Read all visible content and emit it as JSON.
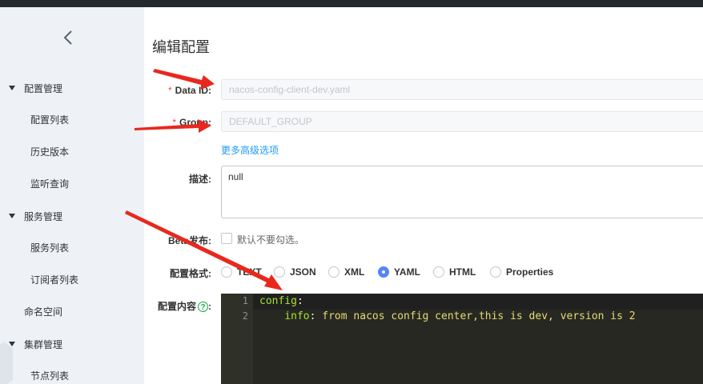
{
  "sidebar": {
    "groups": [
      {
        "label": "配置管理",
        "items": [
          "配置列表",
          "历史版本",
          "监听查询"
        ]
      },
      {
        "label": "服务管理",
        "items": [
          "服务列表",
          "订阅者列表"
        ]
      },
      {
        "label": "集群管理",
        "items": [
          "节点列表"
        ]
      }
    ],
    "namespace": "命名空间"
  },
  "page": {
    "title": "编辑配置"
  },
  "form": {
    "data_id": {
      "label": "Data ID:",
      "value": "nacos-config-client-dev.yaml"
    },
    "group": {
      "label": "Group:",
      "value": "DEFAULT_GROUP"
    },
    "more_options": "更多高级选项",
    "desc": {
      "label": "描述:",
      "value": "null"
    },
    "beta": {
      "label": "Beta发布:",
      "checkbox_text": "默认不要勾选。"
    },
    "format": {
      "label": "配置格式:",
      "options": [
        "TEXT",
        "JSON",
        "XML",
        "YAML",
        "HTML",
        "Properties"
      ],
      "selected": "YAML"
    },
    "content": {
      "label": "配置内容",
      "help": "?",
      "colon": ":"
    }
  },
  "editor": {
    "lines": [
      {
        "num": "1",
        "key": "config",
        "sep": ":",
        "value": ""
      },
      {
        "num": "2",
        "key": "info",
        "sep": ": ",
        "value": "from nacos config center,this is dev, version is 2"
      }
    ]
  },
  "colors": {
    "accent": "#5584ff",
    "link": "#209bfa",
    "required": "#f54743",
    "arrow": "#e8281e"
  }
}
